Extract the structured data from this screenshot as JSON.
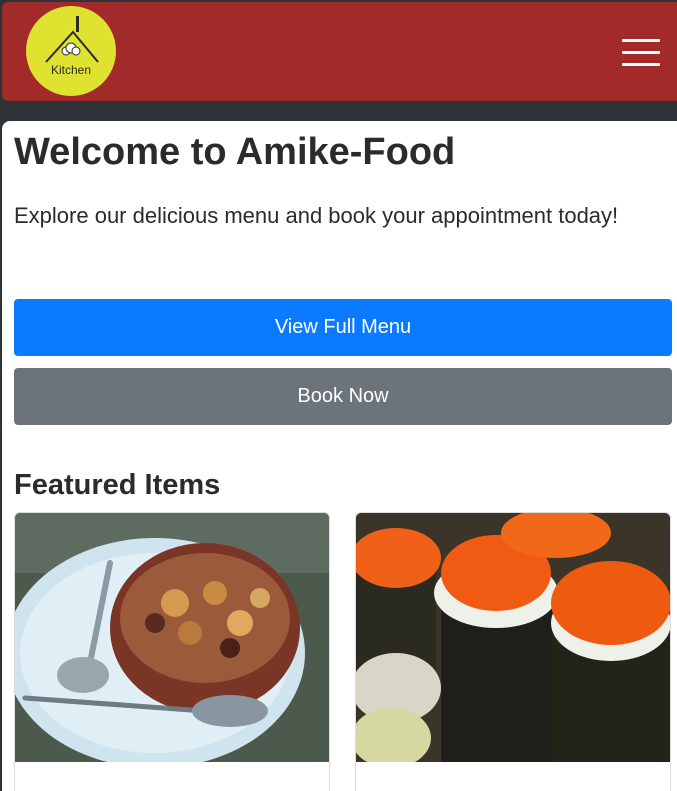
{
  "header": {
    "logo_text": "Kitchen",
    "menu_icon": "hamburger-menu-icon",
    "background": "#a22a2a"
  },
  "main": {
    "title": "Welcome to Amike-Food",
    "lead": "Explore our delicious menu and book your appointment today!",
    "view_menu_label": "View Full Menu",
    "book_now_label": "Book Now"
  },
  "featured": {
    "title": "Featured Items",
    "items": [
      {
        "image": "stew-bowl-dish-image"
      },
      {
        "image": "sushi-rolls-image"
      }
    ]
  },
  "colors": {
    "primary": "#0a7bff",
    "secondary": "#6c737b",
    "logo": "#dfe22f"
  }
}
